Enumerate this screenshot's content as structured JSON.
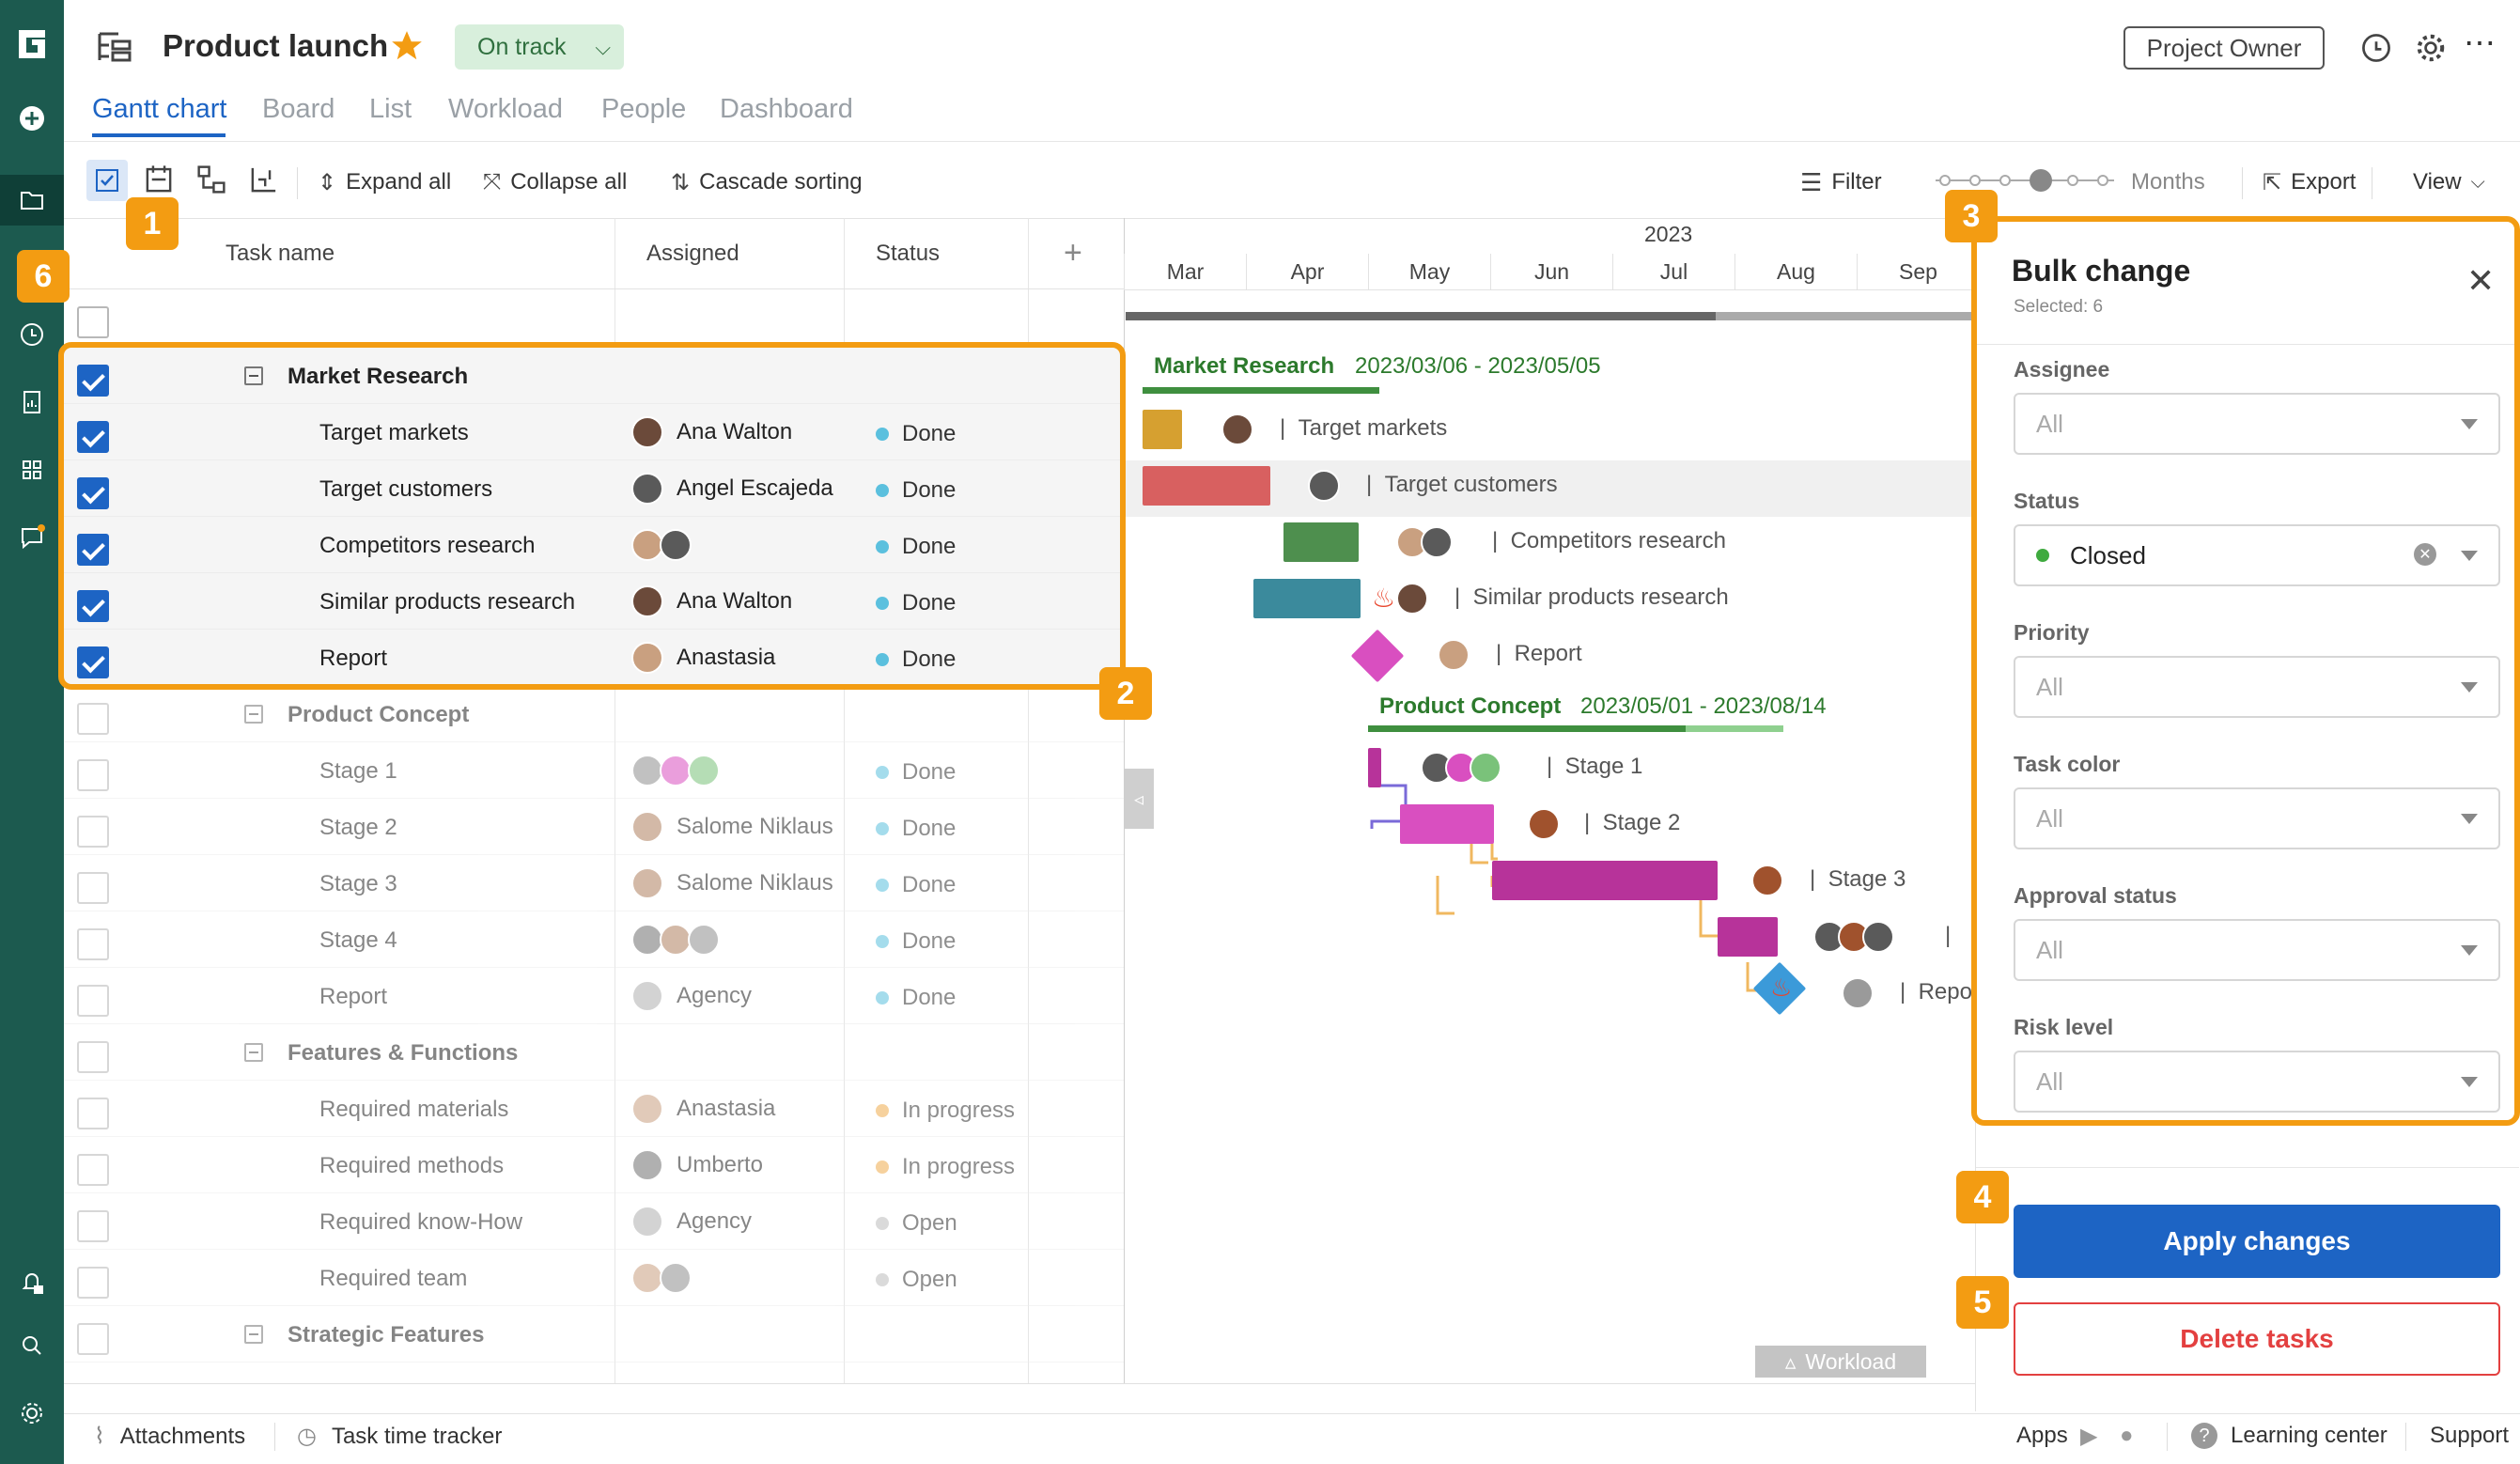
{
  "header": {
    "title": "Product launch",
    "status": "On track",
    "owner_button": "Project Owner",
    "tabs": [
      "Gantt chart",
      "Board",
      "List",
      "Workload",
      "People",
      "Dashboard"
    ]
  },
  "toolbar": {
    "expand_all": "Expand all",
    "collapse_all": "Collapse all",
    "cascade_sorting": "Cascade sorting",
    "filter": "Filter",
    "zoom_label": "Months",
    "export": "Export",
    "view": "View"
  },
  "grid": {
    "columns": [
      "Task name",
      "Assigned",
      "Status"
    ],
    "rows": [
      {
        "name": "Market Research",
        "assignee": "",
        "status": "",
        "group": true,
        "checked": true
      },
      {
        "name": "Target markets",
        "assignee": "Ana Walton",
        "status": "Done",
        "checked": true
      },
      {
        "name": "Target customers",
        "assignee": "Angel Escajeda",
        "status": "Done",
        "checked": true
      },
      {
        "name": "Competitors research",
        "assignee": "",
        "status": "Done",
        "checked": true
      },
      {
        "name": "Similar products research",
        "assignee": "Ana Walton",
        "status": "Done",
        "checked": true
      },
      {
        "name": "Report",
        "assignee": "Anastasia",
        "status": "Done",
        "checked": true
      },
      {
        "name": "Product Concept",
        "assignee": "",
        "status": "",
        "group": true
      },
      {
        "name": "Stage 1",
        "assignee": "",
        "status": "Done"
      },
      {
        "name": "Stage 2",
        "assignee": "Salome Niklaus",
        "status": "Done"
      },
      {
        "name": "Stage 3",
        "assignee": "Salome Niklaus",
        "status": "Done"
      },
      {
        "name": "Stage 4",
        "assignee": "",
        "status": "Done"
      },
      {
        "name": "Report",
        "assignee": "Agency",
        "status": "Done"
      },
      {
        "name": "Features & Functions",
        "assignee": "",
        "status": "",
        "group": true
      },
      {
        "name": "Required materials",
        "assignee": "Anastasia",
        "status": "In progress"
      },
      {
        "name": "Required methods",
        "assignee": "Umberto",
        "status": "In progress"
      },
      {
        "name": "Required know-How",
        "assignee": "Agency",
        "status": "Open"
      },
      {
        "name": "Required team",
        "assignee": "",
        "status": "Open"
      },
      {
        "name": "Strategic Features",
        "assignee": "",
        "status": "",
        "group": true
      }
    ]
  },
  "timeline": {
    "year": "2023",
    "months": [
      "Mar",
      "Apr",
      "May",
      "Jun",
      "Jul",
      "Aug",
      "Sep"
    ],
    "market_research": {
      "name": "Market Research",
      "dates": "2023/03/06 - 2023/05/05"
    },
    "product_concept": {
      "name": "Product Concept",
      "dates": "2023/05/01 - 2023/08/14"
    },
    "bar_labels": [
      "Target markets",
      "Target customers",
      "Competitors research",
      "Similar products research",
      "Report",
      "Stage 1",
      "Stage 2",
      "Stage 3",
      "Repo"
    ],
    "workload_tab": "Workload"
  },
  "bulk_change": {
    "title": "Bulk change",
    "selected": "Selected: 6",
    "fields": [
      {
        "label": "Assignee",
        "value": "All"
      },
      {
        "label": "Status",
        "value": "Closed"
      },
      {
        "label": "Priority",
        "value": "All"
      },
      {
        "label": "Task color",
        "value": "All"
      },
      {
        "label": "Approval status",
        "value": "All"
      },
      {
        "label": "Risk level",
        "value": "All"
      }
    ],
    "apply_button": "Apply changes",
    "delete_button": "Delete tasks"
  },
  "callouts": [
    "1",
    "2",
    "3",
    "4",
    "5",
    "6"
  ],
  "footer": {
    "attachments": "Attachments",
    "time_tracker": "Task time tracker",
    "apps": "Apps",
    "learning_center": "Learning center",
    "support": "Support"
  },
  "colors": {
    "accent": "#1d64c4",
    "sidebar": "#1c5a4f",
    "callout": "#f39c12",
    "done": "#5bc0de",
    "in_progress": "#f0ad4e",
    "open": "#bdbdbd"
  }
}
